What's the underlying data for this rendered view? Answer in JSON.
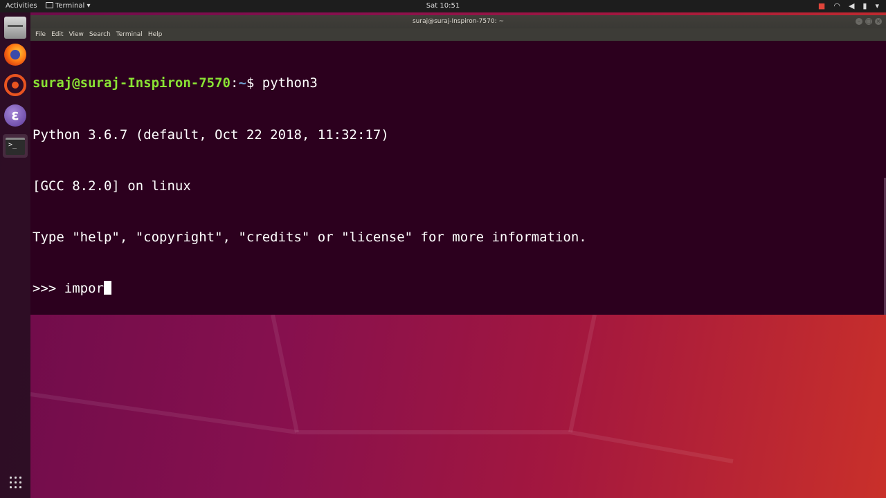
{
  "topbar": {
    "activities": "Activities",
    "app_menu": "Terminal ▾",
    "clock": "Sat 10:51",
    "indicators": [
      "camera-icon",
      "wifi-icon",
      "volume-icon",
      "battery-icon",
      "power-menu-icon"
    ]
  },
  "dock": {
    "items": [
      "files-icon",
      "firefox-icon",
      "software-center-icon",
      "emacs-icon",
      "terminal-icon",
      "show-apps-icon"
    ]
  },
  "window": {
    "title": "suraj@suraj-Inspiron-7570: ~",
    "menu": [
      "File",
      "Edit",
      "View",
      "Search",
      "Terminal",
      "Help"
    ]
  },
  "terminal": {
    "prompt_user": "suraj@suraj-Inspiron-7570",
    "prompt_sep": ":",
    "prompt_path": "~",
    "prompt_dollar": "$ ",
    "command": "python3",
    "output": [
      "Python 3.6.7 (default, Oct 22 2018, 11:32:17)",
      "[GCC 8.2.0] on linux",
      "Type \"help\", \"copyright\", \"credits\" or \"license\" for more information."
    ],
    "repl_prompt": ">>> ",
    "repl_input": "impor"
  },
  "colors": {
    "terminal_bg": "#2c001e",
    "prompt_user": "#8ae234",
    "prompt_path": "#729fcf"
  }
}
